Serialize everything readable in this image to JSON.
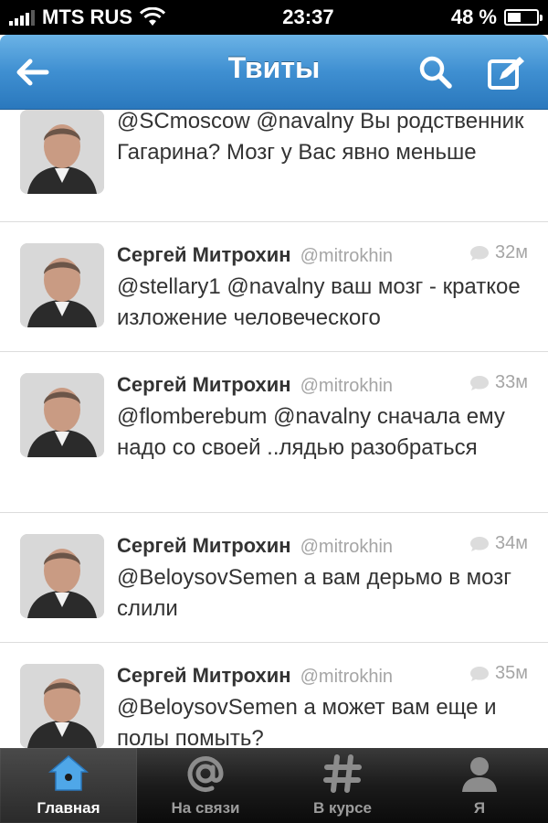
{
  "status_bar": {
    "carrier": "MTS RUS",
    "time": "23:37",
    "battery_percent": "48 %",
    "battery_level": 0.48
  },
  "nav": {
    "title": "Твиты",
    "back_icon": "arrow-left-icon",
    "search_icon": "search-icon",
    "compose_icon": "compose-icon"
  },
  "tweets": [
    {
      "text": "@SCmoscow @navalny Вы родственник Гагарина? Мозг у Вас явно меньше"
    },
    {
      "name": "Сергей Митрохин",
      "handle": "@mitrokhin",
      "time": "32м",
      "text": "@stellary1 @navalny ваш мозг - краткое изложение человеческого"
    },
    {
      "name": "Сергей Митрохин",
      "handle": "@mitrokhin",
      "time": "33м",
      "text": "@flomberebum @navalny сначала ему надо со своей ..лядью разобраться"
    },
    {
      "name": "Сергей Митрохин",
      "handle": "@mitrokhin",
      "time": "34м",
      "text": "@BeloysovSemen а вам дерьмо в мозг слили"
    },
    {
      "name": "Сергей Митрохин",
      "handle": "@mitrokhin",
      "time": "35м",
      "text": "@BeloysovSemen а может вам еще и полы помыть?"
    }
  ],
  "tab_bar": {
    "tabs": [
      {
        "label": "Главная",
        "icon": "home-icon",
        "active": true
      },
      {
        "label": "На связи",
        "icon": "at-icon",
        "active": false
      },
      {
        "label": "В курсе",
        "icon": "hashtag-icon",
        "active": false
      },
      {
        "label": "Я",
        "icon": "person-icon",
        "active": false
      }
    ]
  },
  "colors": {
    "nav_blue": "#3f8fd1",
    "text": "#333333",
    "muted": "#a5a5a5",
    "tab_bg": "#1b1b1b",
    "home_blue": "#4fa7e8"
  }
}
